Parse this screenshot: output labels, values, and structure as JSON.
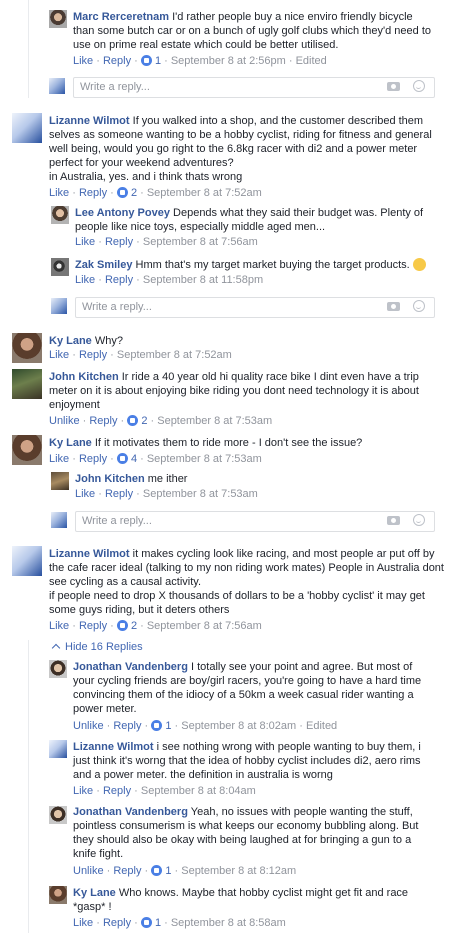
{
  "common": {
    "like": "Like",
    "unlike": "Unlike",
    "reply": "Reply",
    "sep": "·",
    "write_placeholder": "Write a reply...",
    "camera_icon": "camera-icon",
    "emoji_icon": "emoji-icon"
  },
  "comments": [
    {
      "id": "c1",
      "name": "Marc Rerceretnam",
      "text": "I'd rather people buy a nice enviro friendly bicycle than some butch car or on a bunch of ugly golf clubs which they'd need to use on prime real estate which could be better utilised.",
      "action": "Like",
      "count": "1",
      "time": "September 8 at 2:56pm",
      "edited": "Edited"
    },
    {
      "id": "c2",
      "name": "Lizanne Wilmot",
      "text": "If you walked into a shop, and the customer described them selves as someone wanting to be a hobby cyclist, riding for fitness and general well being, would you go right to the 6.8kg racer with di2 and a power meter perfect for your weekend adventures?",
      "text2": "in Australia, yes. and i think thats wrong",
      "action": "Like",
      "count": "2",
      "time": "September 8 at 7:52am"
    },
    {
      "id": "c3",
      "name": "Lee Antony Povey",
      "text": "Depends what they said their budget was. Plenty of people like nice toys, especially middle aged men...",
      "action": "Like",
      "time": "September 8 at 7:56am"
    },
    {
      "id": "c4",
      "name": "Zak Smiley",
      "text": "Hmm that's my target market buying the target products.",
      "action": "Like",
      "time": "September 8 at 11:58pm"
    },
    {
      "id": "c5",
      "name": "Ky Lane",
      "text": "Why?",
      "action": "Like",
      "time": "September 8 at 7:52am"
    },
    {
      "id": "c6",
      "name": "John Kitchen",
      "text": "Ir ride a 40 year old hi quality race bike I dint even have a trip meter on it is about enjoying bike riding you dont need technology it is about enjoyment",
      "action": "Unlike",
      "count": "2",
      "time": "September 8 at 7:53am"
    },
    {
      "id": "c7",
      "name": "Ky Lane",
      "text": "If it motivates them to ride more - I don't see the issue?",
      "action": "Like",
      "count": "4",
      "time": "September 8 at 7:53am"
    },
    {
      "id": "c8",
      "name": "John Kitchen",
      "text": "me ither",
      "action": "Like",
      "time": "September 8 at 7:53am"
    },
    {
      "id": "c9",
      "name": "Lizanne Wilmot",
      "text": "it makes cycling look like racing, and most people ar put off by the cafe racer ideal (talking to my non riding work mates) People in Australia dont see cycling as a causal activity.",
      "text2": "if people need to drop X thousands of dollars to be a 'hobby cyclist' it may get some guys riding, but it deters others",
      "action": "Like",
      "count": "2",
      "time": "September 8 at 7:56am"
    },
    {
      "id": "c10",
      "name": "Jonathan Vandenberg",
      "text": "I totally see your point and agree. But most of your cycling friends are boy/girl racers, you're going to have a hard time convincing them of the idiocy of a 50km a week casual rider wanting a power meter.",
      "action": "Unlike",
      "count": "1",
      "time": "September 8 at 8:02am",
      "edited": "Edited"
    },
    {
      "id": "c11",
      "name": "Lizanne Wilmot",
      "text": "i see nothing wrong with people wanting to buy them, i just think it's worng that the idea of hobby cyclist includes di2, aero rims and a power meter. the definition in australia is worng",
      "action": "Like",
      "time": "September 8 at 8:04am"
    },
    {
      "id": "c12",
      "name": "Jonathan Vandenberg",
      "text": "Yeah, no issues with people wanting the stuff, pointless consumerism is what keeps our economy bubbling along. But they should also be okay with being laughed at for bringing a gun to a knife fight.",
      "action": "Unlike",
      "count": "1",
      "time": "September 8 at 8:12am"
    },
    {
      "id": "c13",
      "name": "Ky Lane",
      "text": "Who knows. Maybe that hobby cyclist might get fit and race *gasp* !",
      "action": "Like",
      "count": "1",
      "time": "September 8 at 8:58am"
    }
  ],
  "hide_replies": "Hide 16 Replies"
}
